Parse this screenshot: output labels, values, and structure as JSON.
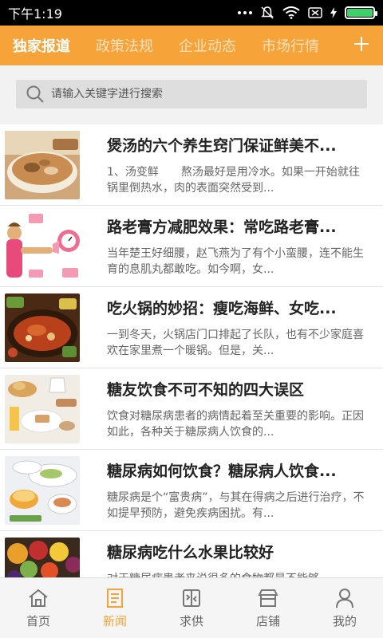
{
  "status_bar": {
    "time": "下午1:19"
  },
  "tabs": [
    {
      "label": "独家报道",
      "active": true
    },
    {
      "label": "政策法规",
      "active": false
    },
    {
      "label": "企业动态",
      "active": false
    },
    {
      "label": "市场行情",
      "active": false
    }
  ],
  "search": {
    "placeholder": "请输入关键字进行搜索"
  },
  "news": [
    {
      "title": "煲汤的六个养生窍门保证鲜美不...",
      "summary": "1、汤变鲜　　熬汤最好是用冷水。如果一开始就往锅里倒热水，肉的表面突然受到..."
    },
    {
      "title": "路老膏方减肥效果：常吃路老膏...",
      "summary": "当年楚王好细腰，赵飞燕为了有个小蛮腰，连不能生育的息肌丸都敢吃。如今啊，女..."
    },
    {
      "title": "吃火锅的妙招：瘦吃海鲜、女吃...",
      "summary": "一到冬天，火锅店门口排起了长队，也有不少家庭喜欢在家里煮一个暖锅。但是，关..."
    },
    {
      "title": "糖友饮食不可不知的四大误区",
      "summary": "饮食对糖尿病患者的病情起着至关重要的影响。正因如此，各种关于糖尿病人饮食的..."
    },
    {
      "title": "糖尿病如何饮食？糖尿病人饮食...",
      "summary": "糖尿病是个“富贵病”，与其在得病之后进行治疗，不如提早预防，避免疾病困扰。有..."
    },
    {
      "title": "糖尿病吃什么水果比较好",
      "summary": "对于糖尿病患者来说很多的食物都是不能够..."
    }
  ],
  "bottom_nav": [
    {
      "label": "首页",
      "icon": "home-icon",
      "active": false
    },
    {
      "label": "新闻",
      "icon": "news-icon",
      "active": true
    },
    {
      "label": "求供",
      "icon": "supply-demand-icon",
      "active": false
    },
    {
      "label": "店铺",
      "icon": "store-icon",
      "active": false
    },
    {
      "label": "我的",
      "icon": "user-icon",
      "active": false
    }
  ],
  "colors": {
    "accent": "#f6a33a",
    "tab_inactive": "#fde2bd",
    "battery": "#3ed06a"
  }
}
